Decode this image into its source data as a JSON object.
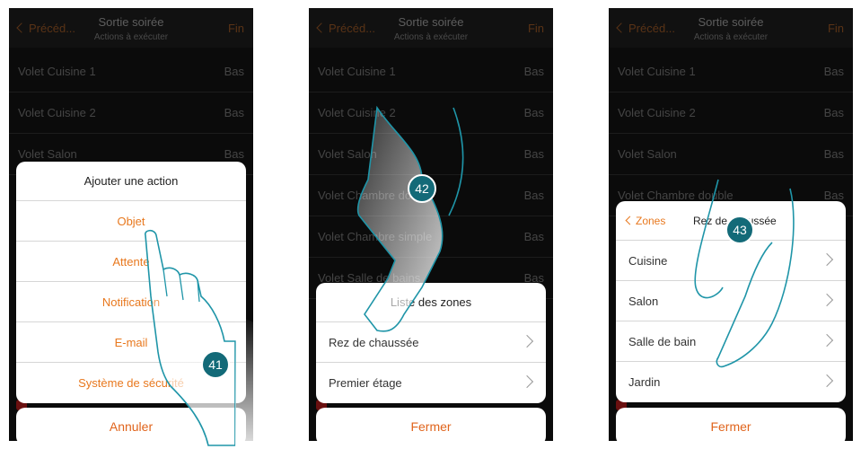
{
  "screens": [
    {
      "nav": {
        "back": "Précéd...",
        "title": "Sortie soirée",
        "subtitle": "Actions à exécuter",
        "done": "Fin"
      },
      "rows": [
        {
          "name": "Volet Cuisine 1",
          "value": "Bas"
        },
        {
          "name": "Volet Cuisine 2",
          "value": "Bas"
        },
        {
          "name": "Volet Salon",
          "value": "Bas"
        }
      ],
      "sheet": {
        "title": "Ajouter une action",
        "items": [
          "Objet",
          "Attente",
          "Notification",
          "E-mail",
          "Système de sécurité"
        ]
      },
      "button": "Annuler",
      "badge": "41"
    },
    {
      "nav": {
        "back": "Précéd...",
        "title": "Sortie soirée",
        "subtitle": "Actions à exécuter",
        "done": "Fin"
      },
      "rows": [
        {
          "name": "Volet Cuisine 1",
          "value": "Bas"
        },
        {
          "name": "Volet Cuisine 2",
          "value": "Bas"
        },
        {
          "name": "Volet Salon",
          "value": "Bas"
        },
        {
          "name": "Volet Chambre double",
          "value": "Bas"
        },
        {
          "name": "Volet Chambre simple",
          "value": "Bas"
        },
        {
          "name": "Volet Salle de bains",
          "value": "Bas"
        }
      ],
      "sheet": {
        "title": "Liste des zones",
        "items": [
          "Rez de chaussée",
          "Premier étage"
        ]
      },
      "button": "Fermer",
      "badge": "42"
    },
    {
      "nav": {
        "back": "Précéd...",
        "title": "Sortie soirée",
        "subtitle": "Actions à exécuter",
        "done": "Fin"
      },
      "rows": [
        {
          "name": "Volet Cuisine 1",
          "value": "Bas"
        },
        {
          "name": "Volet Cuisine 2",
          "value": "Bas"
        },
        {
          "name": "Volet Salon",
          "value": "Bas"
        },
        {
          "name": "Volet Chambre double",
          "value": "Bas"
        }
      ],
      "sheet": {
        "back": "Zones",
        "title": "Rez de chaussée",
        "items": [
          "Cuisine",
          "Salon",
          "Salle de bain",
          "Jardin"
        ]
      },
      "button": "Fermer",
      "badge": "43"
    }
  ]
}
